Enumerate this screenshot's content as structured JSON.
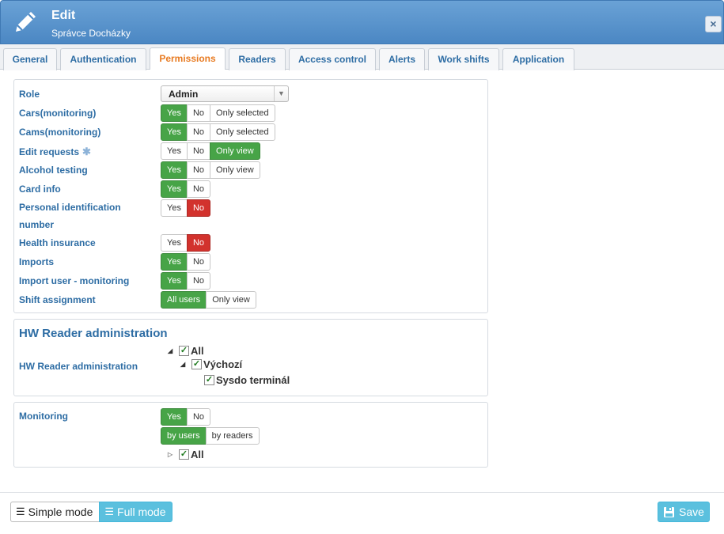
{
  "header": {
    "title": "Edit",
    "subtitle": "Správce Docházky",
    "close_icon": "×"
  },
  "tabs": [
    {
      "label": "General"
    },
    {
      "label": "Authentication"
    },
    {
      "label": "Permissions",
      "active": true
    },
    {
      "label": "Readers"
    },
    {
      "label": "Access control"
    },
    {
      "label": "Alerts"
    },
    {
      "label": "Work shifts"
    },
    {
      "label": "Application"
    }
  ],
  "permissions": {
    "role_label": "Role",
    "role_value": "Admin",
    "rows": [
      {
        "label": "Cars(monitoring)",
        "options": [
          "Yes",
          "No",
          "Only selected"
        ],
        "selected": "Yes"
      },
      {
        "label": "Cams(monitoring)",
        "options": [
          "Yes",
          "No",
          "Only selected"
        ],
        "selected": "Yes"
      },
      {
        "label": "Edit requests",
        "options": [
          "Yes",
          "No",
          "Only view"
        ],
        "selected": "Only view",
        "asterisk": "✱"
      },
      {
        "label": "Alcohol testing",
        "options": [
          "Yes",
          "No",
          "Only view"
        ],
        "selected": "Yes"
      },
      {
        "label": "Card info",
        "options": [
          "Yes",
          "No"
        ],
        "selected": "Yes"
      },
      {
        "label": "Personal identification",
        "label2": "number",
        "options": [
          "Yes",
          "No"
        ],
        "selected": "No"
      },
      {
        "label": "Health insurance",
        "options": [
          "Yes",
          "No"
        ],
        "selected": "No"
      },
      {
        "label": "Imports",
        "options": [
          "Yes",
          "No"
        ],
        "selected": "Yes"
      },
      {
        "label": "Import user - monitoring",
        "options": [
          "Yes",
          "No"
        ],
        "selected": "Yes"
      },
      {
        "label": "Shift assignment",
        "options": [
          "All users",
          "Only view"
        ],
        "selected": "All users"
      }
    ]
  },
  "hw_reader": {
    "section_title": "HW Reader administration",
    "row_label": "HW Reader administration",
    "tree": [
      {
        "label": "All",
        "checked": true,
        "expanded": true
      },
      {
        "label": "Výchozí",
        "checked": true,
        "expanded": true
      },
      {
        "label": "Sysdo terminál",
        "checked": true
      }
    ]
  },
  "monitoring": {
    "label": "Monitoring",
    "options": [
      "Yes",
      "No"
    ],
    "selected": "Yes",
    "mode_options": [
      "by users",
      "by readers"
    ],
    "mode_selected": "by users",
    "tree_all": "All"
  },
  "footer": {
    "simple_mode": "Simple mode",
    "full_mode": "Full mode",
    "save": "Save"
  },
  "colors": {
    "header": "#4b87c3",
    "selected_green": "#47a447",
    "selected_red": "#d2322d",
    "label_blue": "#2e6da4",
    "active_tab": "#e87b22",
    "info": "#5bc0de"
  }
}
